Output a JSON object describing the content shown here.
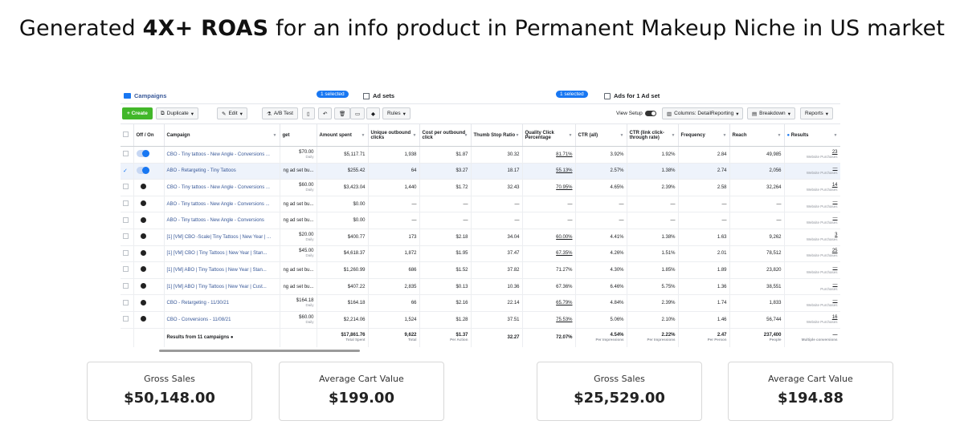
{
  "headline": {
    "prefix": "Generated",
    "bold": "4X+ ROAS",
    "suffix": "for an info product in Permanent Makeup Niche in US market"
  },
  "topbar": {
    "campaigns": "Campaigns",
    "selected_pill": "1 selected",
    "ad_sets": "Ad sets",
    "ads_pill": "1 selected",
    "ads_for": "Ads for 1 Ad set"
  },
  "toolbar": {
    "create": "+ Create",
    "duplicate": "Duplicate",
    "edit": "Edit",
    "ab_test": "A/B Test",
    "rules": "Rules",
    "view_setup": "View Setup",
    "columns": "Columns: DetailReporting",
    "breakdown": "Breakdown",
    "reports": "Reports"
  },
  "columns": [
    "Off / On",
    "Campaign",
    "get",
    "Amount spent",
    "Unique outbound clicks",
    "Cost per outbound click",
    "Thumb Stop Ratio",
    "Quality Click Percentage",
    "CTR (all)",
    "CTR (link click-through rate)",
    "Frequency",
    "Reach",
    "Results"
  ],
  "rows": [
    {
      "on": true,
      "selected": false,
      "campaign": "CBO - Tiny tattoos - New Angle - Conversions ...",
      "budget": "$70.00",
      "budget_sub": "Daily",
      "spent": "$5,117.71",
      "clicks": "1,938",
      "cpc": "$1.87",
      "tsr": "30.32",
      "qcp": "81.71%",
      "qcp_u": true,
      "ctr": "3.92%",
      "ctr_link": "1.92%",
      "freq": "2.84",
      "reach": "49,985",
      "results": "23",
      "results_sub": "Website Purchases"
    },
    {
      "on": true,
      "selected": true,
      "campaign": "ABO - Retargeting - Tiny Tattoos",
      "budget": "ng ad set bu...",
      "budget_sub": "",
      "spent": "$255.42",
      "clicks": "64",
      "cpc": "$3.27",
      "tsr": "18.17",
      "qcp": "55.13%",
      "qcp_u": true,
      "ctr": "2.57%",
      "ctr_link": "1.38%",
      "freq": "2.74",
      "reach": "2,056",
      "results": "—",
      "results_sub": "Website Purchases"
    },
    {
      "on": false,
      "selected": false,
      "campaign": "CBO - Tiny tattoos - New Angle - Conversions ...",
      "budget": "$60.00",
      "budget_sub": "Daily",
      "spent": "$3,423.04",
      "clicks": "1,440",
      "cpc": "$1.72",
      "tsr": "32.43",
      "qcp": "70.95%",
      "qcp_u": true,
      "ctr": "4.65%",
      "ctr_link": "2.39%",
      "freq": "2.58",
      "reach": "32,264",
      "results": "14",
      "results_sub": "Website Purchases"
    },
    {
      "on": false,
      "selected": false,
      "campaign": "ABO - Tiny tattoos - New Angle - Conversions ...",
      "budget": "ng ad set bu...",
      "budget_sub": "",
      "spent": "$0.00",
      "clicks": "—",
      "cpc": "—",
      "tsr": "—",
      "qcp": "—",
      "qcp_u": false,
      "ctr": "—",
      "ctr_link": "—",
      "freq": "—",
      "reach": "—",
      "results": "—",
      "results_sub": "Website Purchases"
    },
    {
      "on": false,
      "selected": false,
      "campaign": "ABO - Tiny tattoos - New Angle - Conversions",
      "budget": "ng ad set bu...",
      "budget_sub": "",
      "spent": "$0.00",
      "clicks": "—",
      "cpc": "—",
      "tsr": "—",
      "qcp": "—",
      "qcp_u": false,
      "ctr": "—",
      "ctr_link": "—",
      "freq": "—",
      "reach": "—",
      "results": "—",
      "results_sub": "Website Purchases"
    },
    {
      "on": false,
      "selected": false,
      "campaign": "[1] [VM] CBO -Scale| Tiny Tattoos | New Year | ...",
      "budget": "$20.00",
      "budget_sub": "Daily",
      "spent": "$400.77",
      "clicks": "173",
      "cpc": "$2.18",
      "tsr": "34.04",
      "qcp": "60.00%",
      "qcp_u": true,
      "ctr": "4.41%",
      "ctr_link": "1.38%",
      "freq": "1.63",
      "reach": "9,262",
      "results": "3",
      "results_sub": "Website Purchases"
    },
    {
      "on": false,
      "selected": false,
      "campaign": "[1] [VM] CBO | Tiny Tattoos | New Year | Stan...",
      "budget": "$45.00",
      "budget_sub": "Daily",
      "spent": "$4,618.37",
      "clicks": "1,872",
      "cpc": "$1.95",
      "tsr": "37.47",
      "qcp": "67.35%",
      "qcp_u": true,
      "ctr": "4.26%",
      "ctr_link": "1.51%",
      "freq": "2.01",
      "reach": "78,512",
      "results": "25",
      "results_sub": "Website Purchases"
    },
    {
      "on": false,
      "selected": false,
      "campaign": "[1] [VM] ABO | Tiny Tattoos | New Year | Stan...",
      "budget": "ng ad set bu...",
      "budget_sub": "",
      "spent": "$1,260.99",
      "clicks": "686",
      "cpc": "$1.52",
      "tsr": "37.82",
      "qcp": "71.27%",
      "qcp_u": false,
      "ctr": "4.30%",
      "ctr_link": "1.85%",
      "freq": "1.89",
      "reach": "23,820",
      "results": "—",
      "results_sub": "Website Purchases"
    },
    {
      "on": false,
      "selected": false,
      "campaign": "[1] [VM] ABO | Tiny Tattoos | New Year | Cust...",
      "budget": "ng ad set bu...",
      "budget_sub": "",
      "spent": "$407.22",
      "clicks": "2,835",
      "cpc": "$0.13",
      "tsr": "10.36",
      "qcp": "67.36%",
      "qcp_u": false,
      "ctr": "6.46%",
      "ctr_link": "5.75%",
      "freq": "1.36",
      "reach": "38,551",
      "results": "—",
      "results_sub": "Purchases"
    },
    {
      "on": false,
      "selected": false,
      "campaign": "CBO - Retargeting - 11/30/21",
      "budget": "$164.18",
      "budget_sub": "Daily",
      "spent": "$164.18",
      "clicks": "66",
      "cpc": "$2.16",
      "tsr": "22.14",
      "qcp": "65.79%",
      "qcp_u": true,
      "ctr": "4.84%",
      "ctr_link": "2.39%",
      "freq": "1.74",
      "reach": "1,833",
      "results": "—",
      "results_sub": "Website Purchases"
    },
    {
      "on": false,
      "selected": false,
      "campaign": "CBO - Conversions - 11/08/21",
      "budget": "$60.00",
      "budget_sub": "Daily",
      "spent": "$2,214.06",
      "clicks": "1,524",
      "cpc": "$1.28",
      "tsr": "37.51",
      "qcp": "75.53%",
      "qcp_u": true,
      "ctr": "5.06%",
      "ctr_link": "2.10%",
      "freq": "1.46",
      "reach": "56,744",
      "results": "16",
      "results_sub": "Website Purchases"
    }
  ],
  "totals": {
    "label": "Results from 11 campaigns",
    "spent": "$17,861.76",
    "spent_sub": "Total Spent",
    "clicks": "9,622",
    "clicks_sub": "Total",
    "cpc": "$1.37",
    "cpc_sub": "Per Action",
    "tsr": "32.27",
    "qcp": "72.07%",
    "ctr": "4.54%",
    "ctr_sub": "Per Impressions",
    "ctr_link": "2.22%",
    "ctr_link_sub": "Per Impressions",
    "freq": "2.47",
    "freq_sub": "Per Person",
    "reach": "237,400",
    "reach_sub": "People",
    "results": "—",
    "results_sub": "Multiple conversions"
  },
  "cards": [
    {
      "label": "Gross Sales",
      "value": "$50,148.00"
    },
    {
      "label": "Average Cart Value",
      "value": "$199.00"
    },
    {
      "label": "Gross Sales",
      "value": "$25,529.00"
    },
    {
      "label": "Average Cart Value",
      "value": "$194.88"
    }
  ]
}
